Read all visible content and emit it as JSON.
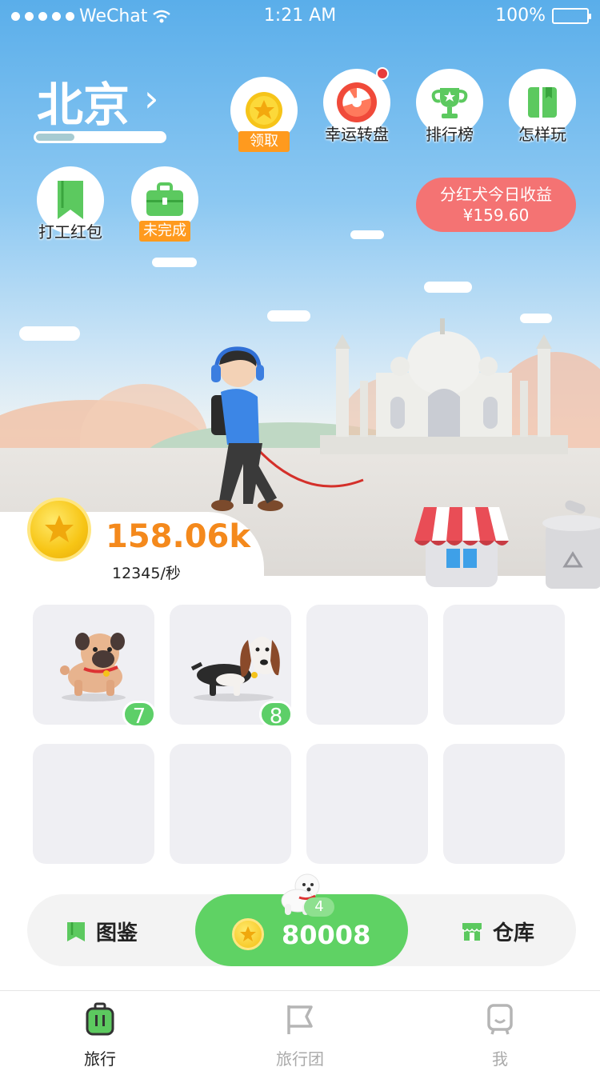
{
  "status_bar": {
    "carrier": "WeChat",
    "time": "1:21 AM",
    "battery": "100%"
  },
  "city": {
    "name": "北京",
    "progress": 0.3
  },
  "top_buttons": [
    {
      "name": "claim",
      "tag": "领取"
    },
    {
      "name": "wheel",
      "label": "幸运转盘"
    },
    {
      "name": "leaderboard",
      "label": "排行榜"
    },
    {
      "name": "how-to-play",
      "label": "怎样玩"
    }
  ],
  "second_buttons": [
    {
      "name": "work-redpacket",
      "label": "打工红包"
    },
    {
      "name": "task",
      "tag": "未完成"
    }
  ],
  "dividend": {
    "title": "分红犬今日收益",
    "amount": "¥159.60"
  },
  "coins": {
    "total": "158.06k",
    "rate": "12345/秒"
  },
  "slots": [
    {
      "dog": "pug",
      "level": "7"
    },
    {
      "dog": "basset-hound",
      "level": "8"
    },
    {},
    {},
    {},
    {},
    {},
    {}
  ],
  "action_bar": {
    "catalog_label": "图鉴",
    "buy_price": "80008",
    "buy_level": "4",
    "warehouse_label": "仓库"
  },
  "tabs": [
    {
      "label": "旅行",
      "active": true
    },
    {
      "label": "旅行团",
      "active": false
    },
    {
      "label": "我",
      "active": false
    }
  ],
  "colors": {
    "sky_top": "#5aaeea",
    "accent_green": "#5fd264",
    "coin_orange": "#f4891c",
    "dividend_red": "#f47373",
    "tag_orange": "#ff9a1e"
  }
}
